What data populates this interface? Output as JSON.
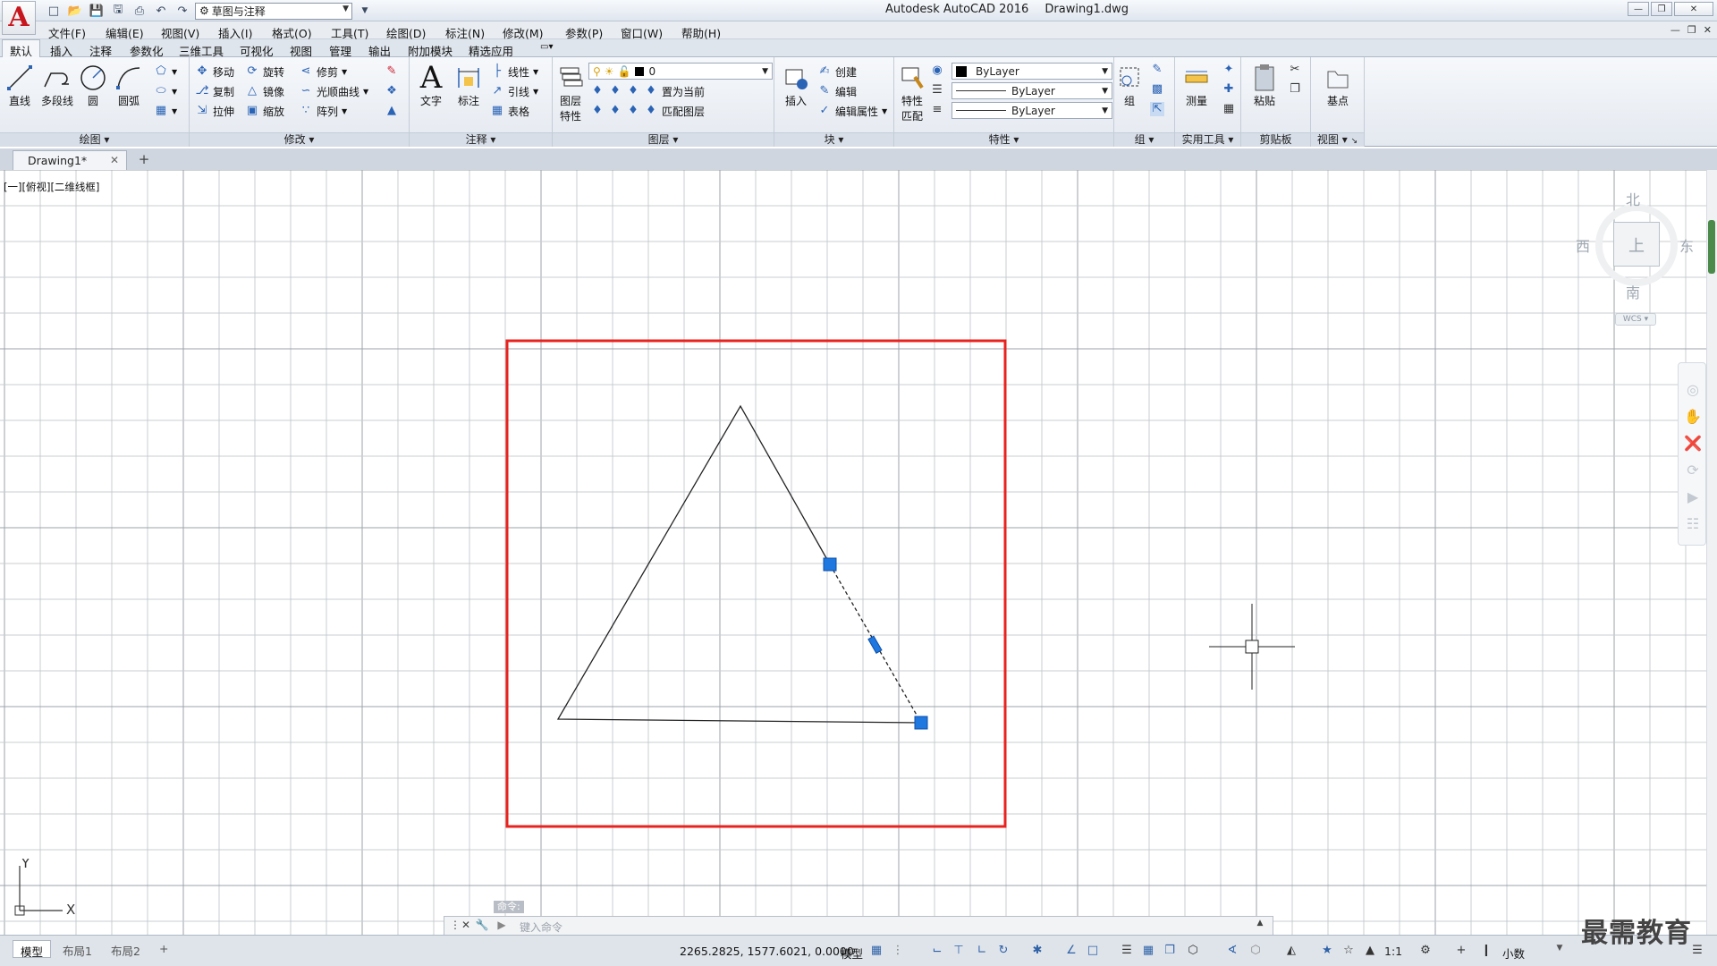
{
  "app": {
    "logo_letter": "A",
    "title": "Autodesk AutoCAD 2016",
    "document": "Drawing1.dwg",
    "workspace": "草图与注释"
  },
  "menu": [
    "文件(F)",
    "编辑(E)",
    "视图(V)",
    "插入(I)",
    "格式(O)",
    "工具(T)",
    "绘图(D)",
    "标注(N)",
    "修改(M)",
    "参数(P)",
    "窗口(W)",
    "帮助(H)"
  ],
  "ribbon_tabs": [
    "默认",
    "插入",
    "注释",
    "参数化",
    "三维工具",
    "可视化",
    "视图",
    "管理",
    "输出",
    "附加模块",
    "精选应用"
  ],
  "ribbon": {
    "draw": {
      "title": "绘图",
      "line": "直线",
      "polyline": "多段线",
      "circle": "圆",
      "arc": "圆弧"
    },
    "modify": {
      "title": "修改",
      "move": "移动",
      "rotate": "旋转",
      "trim": "修剪",
      "copy": "复制",
      "mirror": "镜像",
      "fillet": "光顺曲线",
      "stretch": "拉伸",
      "scale": "缩放",
      "array": "阵列"
    },
    "annotation": {
      "title": "注释",
      "text": "文字",
      "dimension": "标注",
      "linear": "线性",
      "leader": "引线",
      "table": "表格"
    },
    "layers": {
      "title": "图层",
      "properties": "图层",
      "properties2": "特性",
      "current_layer": "0",
      "set_current": "置为当前",
      "match_layer": "匹配图层"
    },
    "block": {
      "title": "块",
      "insert": "插入",
      "create": "创建",
      "edit": "编辑",
      "edit_attr": "编辑属性"
    },
    "properties": {
      "title": "特性",
      "match": "特性",
      "match2": "匹配",
      "color": "ByLayer",
      "linetype": "ByLayer",
      "lineweight": "ByLayer"
    },
    "groups": {
      "title": "组",
      "group": "组"
    },
    "utilities": {
      "title": "实用工具",
      "measure": "测量"
    },
    "clipboard": {
      "title": "剪贴板",
      "paste": "粘贴"
    },
    "view": {
      "title": "视图",
      "base": "基点"
    }
  },
  "file_tab": {
    "name": "Drawing1*"
  },
  "viewport_label": "[一][俯视][二维线框]",
  "viewcube": {
    "north": "北",
    "south": "南",
    "east": "东",
    "west": "西",
    "cube_face": "上",
    "wcs": "WCS"
  },
  "command": {
    "history": "命令:",
    "placeholder": "键入命令"
  },
  "ucs": {
    "x": "X",
    "y": "Y"
  },
  "layout_tabs": [
    "模型",
    "布局1",
    "布局2"
  ],
  "status": {
    "coords": "2265.2825, 1577.6021, 0.0000",
    "model": "模型",
    "scale": "1:1",
    "units": "小数"
  },
  "watermark": "最需教育",
  "colors": {
    "accent": "#2b63b5",
    "highlight_box": "#e8231f",
    "grip": "#1f77e0"
  }
}
